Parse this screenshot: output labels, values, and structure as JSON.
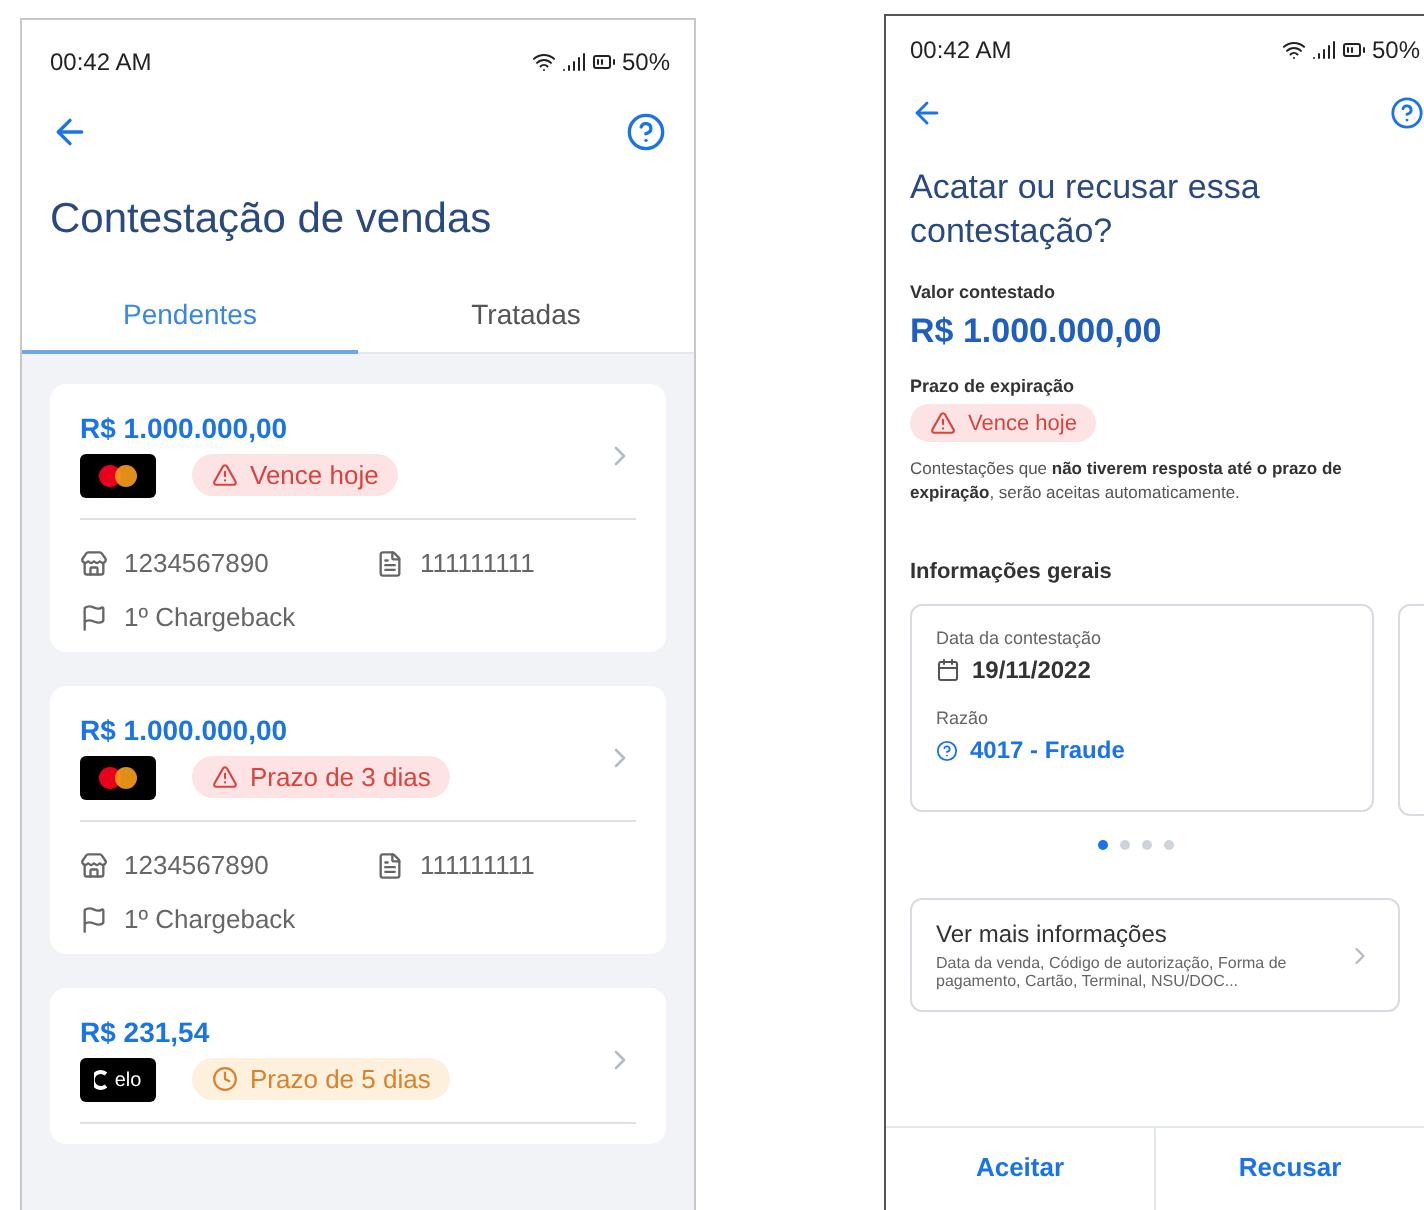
{
  "list_screen": {
    "status_bar": {
      "time": "00:42 AM",
      "battery": "50%"
    },
    "title": "Contestação de vendas",
    "tabs": [
      {
        "label": "Pendentes",
        "selected": true
      },
      {
        "label": "Tratadas",
        "selected": false
      }
    ],
    "cards": [
      {
        "amount": "R$ 1.000.000,00",
        "brand": {
          "kind": "mastercard"
        },
        "badge": {
          "kind": "danger",
          "label": "Vence hoje"
        },
        "store": "1234567890",
        "document": "111111111",
        "stage": "1º Chargeback"
      },
      {
        "amount": "R$ 1.000.000,00",
        "brand": {
          "kind": "mastercard"
        },
        "badge": {
          "kind": "danger",
          "label": "Prazo de 3 dias"
        },
        "store": "1234567890",
        "document": "111111111",
        "stage": "1º Chargeback"
      },
      {
        "amount": "R$ 231,54",
        "brand": {
          "kind": "elo",
          "text": "elo"
        },
        "badge": {
          "kind": "warning",
          "label": "Prazo de 5 dias"
        }
      }
    ]
  },
  "detail_screen": {
    "status_bar": {
      "time": "00:42 AM",
      "battery": "50%"
    },
    "title": "Acatar ou recusar essa contestação?",
    "amount_label": "Valor contestado",
    "amount": "R$ 1.000.000,00",
    "deadline_label": "Prazo de expiração",
    "badge": {
      "kind": "danger",
      "label": "Vence hoje"
    },
    "note": "Contestações que **não tiverem resposta até o prazo de expiração**, serão aceitas automaticamente.",
    "section_title": "Informações gerais",
    "info_card": {
      "date_label": "Data da contestação",
      "date": "19/11/2022",
      "reason_label": "Razão",
      "reason": "4017 - Fraude"
    },
    "carousel_dots": [
      {
        "selected": true
      },
      {
        "selected": false
      },
      {
        "selected": false
      },
      {
        "selected": false
      }
    ],
    "more_info": {
      "title": "Ver mais informações",
      "description": "Data da venda, Código de autorização, Forma de pagamento, Cartão, Terminal, NSU/DOC..."
    },
    "actions": [
      "Aceitar",
      "Recusar"
    ]
  }
}
